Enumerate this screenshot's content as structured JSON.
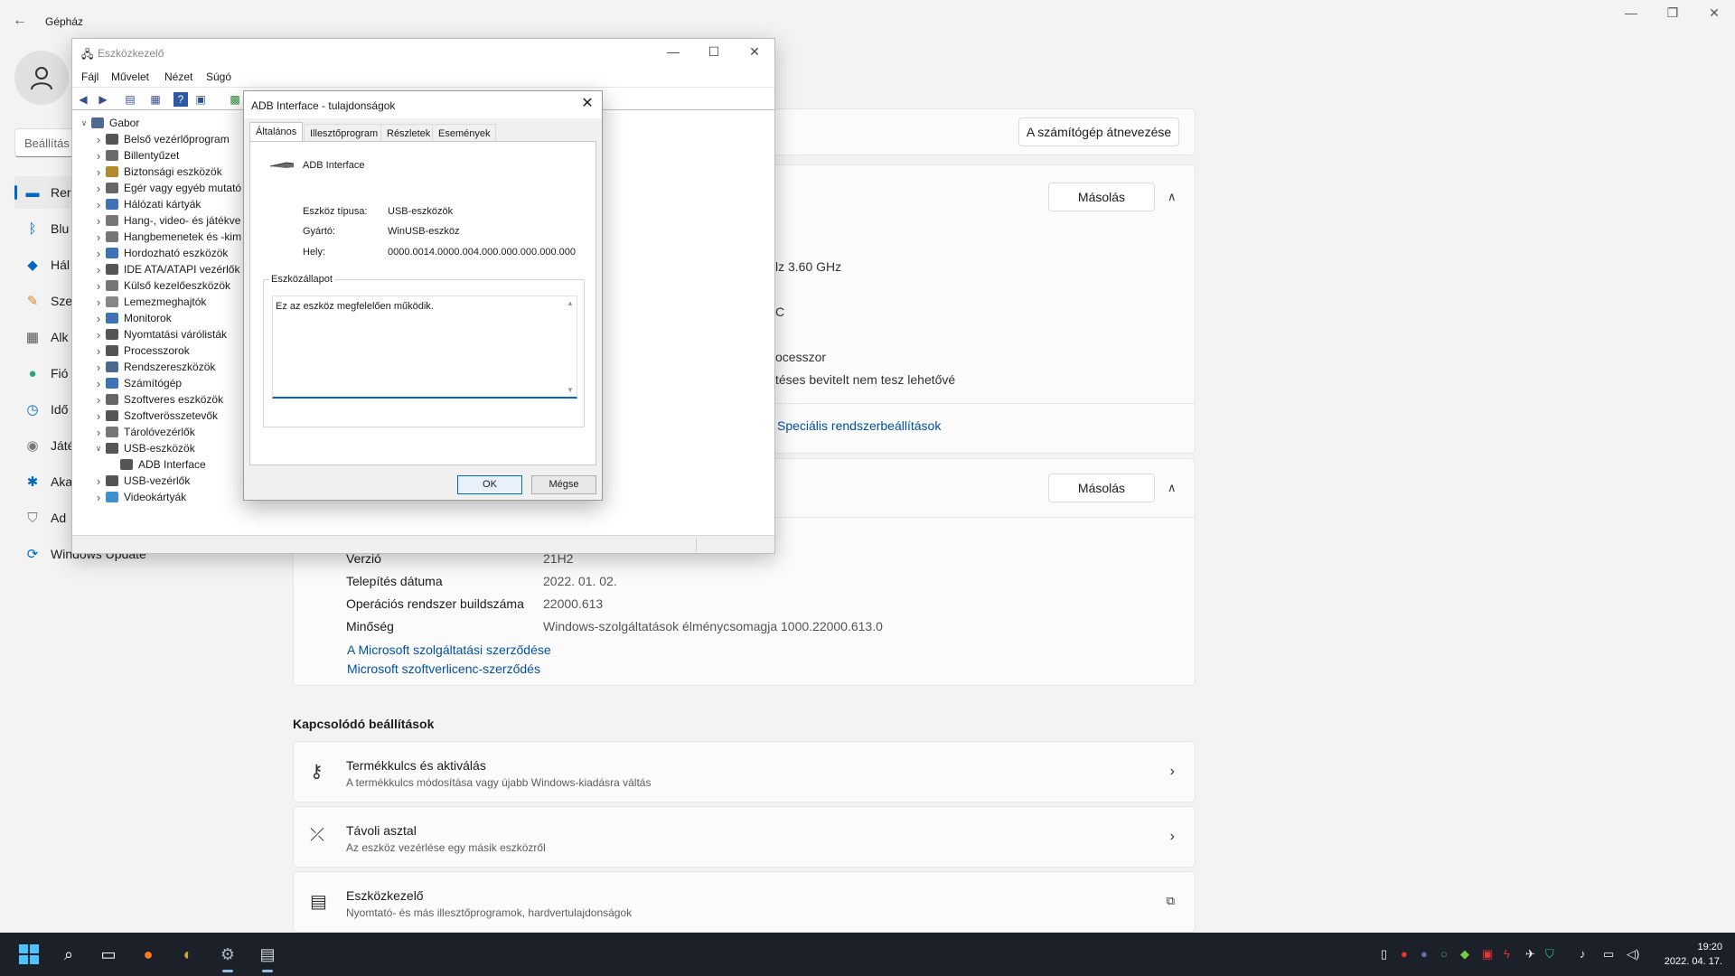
{
  "settings": {
    "app_title": "Gépház",
    "search_placeholder": "Beállítás",
    "nav": [
      {
        "label": "Rer",
        "icon": "monitor-icon"
      },
      {
        "label": "Blu",
        "icon": "bluetooth-icon"
      },
      {
        "label": "Hál",
        "icon": "wifi-icon"
      },
      {
        "label": "Sze",
        "icon": "brush-icon"
      },
      {
        "label": "Alk",
        "icon": "apps-icon"
      },
      {
        "label": "Fió",
        "icon": "person-icon"
      },
      {
        "label": "Idő",
        "icon": "clock-icon"
      },
      {
        "label": "Játé",
        "icon": "gamepad-icon"
      },
      {
        "label": "Aka",
        "icon": "accessibility-icon"
      },
      {
        "label": "Ad",
        "icon": "shield-icon"
      },
      {
        "label": "Windows Update",
        "icon": "update-icon"
      }
    ],
    "rename_button": "A számítógép átnevezése",
    "copy_button_1": "Másolás",
    "copy_button_2": "Másolás",
    "partial_specs": [
      {
        "text": "lz   3.60 GHz"
      },
      {
        "text": "C"
      },
      {
        "text": "ocesszor"
      },
      {
        "text": "téses bevitelt nem tesz lehetővé"
      }
    ],
    "advanced_link": "Speciális rendszerbeállítások",
    "windows_specs": [
      {
        "label": "Verzió",
        "value": "21H2"
      },
      {
        "label": "Telepítés dátuma",
        "value": "2022. 01. 02."
      },
      {
        "label": "Operációs rendszer buildszáma",
        "value": "22000.613"
      },
      {
        "label": "Minőség",
        "value": "Windows-szolgáltatások élménycsomagja 1000.22000.613.0"
      }
    ],
    "links": [
      "A Microsoft szolgáltatási szerződése",
      "Microsoft szoftverlicenc-szerződés"
    ],
    "related_heading": "Kapcsolódó beállítások",
    "related": [
      {
        "title": "Termékkulcs és aktiválás",
        "subtitle": "A termékkulcs módosítása vagy újabb Windows-kiadásra váltás",
        "icon": "key-icon"
      },
      {
        "title": "Távoli asztal",
        "subtitle": "Az eszköz vezérlése egy másik eszközről",
        "icon": "remote-desktop-icon"
      },
      {
        "title": "Eszközkezelő",
        "subtitle": "Nyomtató- és más illesztőprogramok, hardvertulajdonságok",
        "icon": "device-manager-icon"
      }
    ]
  },
  "devmgr": {
    "title": "Eszközkezelő",
    "menu": [
      "Fájl",
      "Művelet",
      "Nézet",
      "Súgó"
    ],
    "root": "Gabor",
    "categories": [
      "Belső vezérlőprogram",
      "Billentyűzet",
      "Biztonsági eszközök",
      "Egér vagy egyéb mutató",
      "Hálózati kártyák",
      "Hang-, video- és játékve",
      "Hangbemenetek és -kim",
      "Hordozható eszközök",
      "IDE ATA/ATAPI vezérlők",
      "Külső kezelőeszközök",
      "Lemezmeghajtók",
      "Monitorok",
      "Nyomtatási várólisták",
      "Processzorok",
      "Rendszereszközök",
      "Számítógép",
      "Szoftveres eszközök",
      "Szoftverösszetevők",
      "Tárolóvezérlők",
      "USB-eszközök",
      "ADB Interface",
      "USB-vezérlők",
      "Videokártyák"
    ]
  },
  "dialog": {
    "title": "ADB Interface - tulajdonságok",
    "tabs": [
      "Általános",
      "Illesztőprogram",
      "Részletek",
      "Események"
    ],
    "device_name": "ADB Interface",
    "props": [
      {
        "label": "Eszköz típusa:",
        "value": "USB-eszközök"
      },
      {
        "label": "Gyártó:",
        "value": "WinUSB-eszköz"
      },
      {
        "label": "Hely:",
        "value": "0000.0014.0000.004.000.000.000.000.000"
      }
    ],
    "status_group": "Eszközállapot",
    "status_text": "Ez az eszköz megfelelően működik.",
    "ok": "OK",
    "cancel": "Mégse"
  },
  "taskbar": {
    "time": "19:20",
    "date": "2022. 04. 17."
  }
}
